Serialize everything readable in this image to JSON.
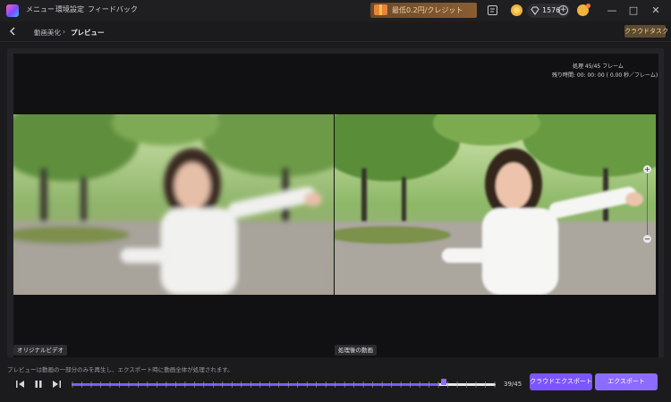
{
  "titlebar": {
    "menu": [
      "メニュー",
      "環境設定",
      "フィードバック"
    ],
    "promo": "最低0.2円/クレジット",
    "gem_count": "1576"
  },
  "breadcrumb": {
    "parent": "動画美化",
    "separator": "›",
    "current": "プレビュー",
    "cloud_task": "クラウドタスク"
  },
  "preview": {
    "frames_label": "処理 45/45 フレーム",
    "remaining_label": "残り時間: 00: 00: 00 ( 0.00 秒／フレーム)",
    "left_tag": "オリジナルビデオ",
    "right_tag": "処理後の動画"
  },
  "bottom": {
    "notice": "プレビューは動画の一部分のみを再生し、エクスポート時に動画全体が処理されます。",
    "progress": {
      "current": 39,
      "total": 45,
      "label": "39/45"
    },
    "cloud_export": "クラウドエクスポート",
    "export": "エクスポート"
  },
  "colors": {
    "accent": "#7b55ff",
    "promo": "#8a5d33",
    "cloud_task": "#5d4a2f"
  },
  "icons": [
    "app-logo-icon",
    "notes-icon",
    "coin-icon",
    "gem-icon",
    "plus-icon",
    "avatar-icon",
    "minimize-icon",
    "maximize-icon",
    "close-icon",
    "back-icon",
    "zoom-in-icon",
    "zoom-out-icon",
    "step-back-icon",
    "pause-icon",
    "step-forward-icon"
  ]
}
